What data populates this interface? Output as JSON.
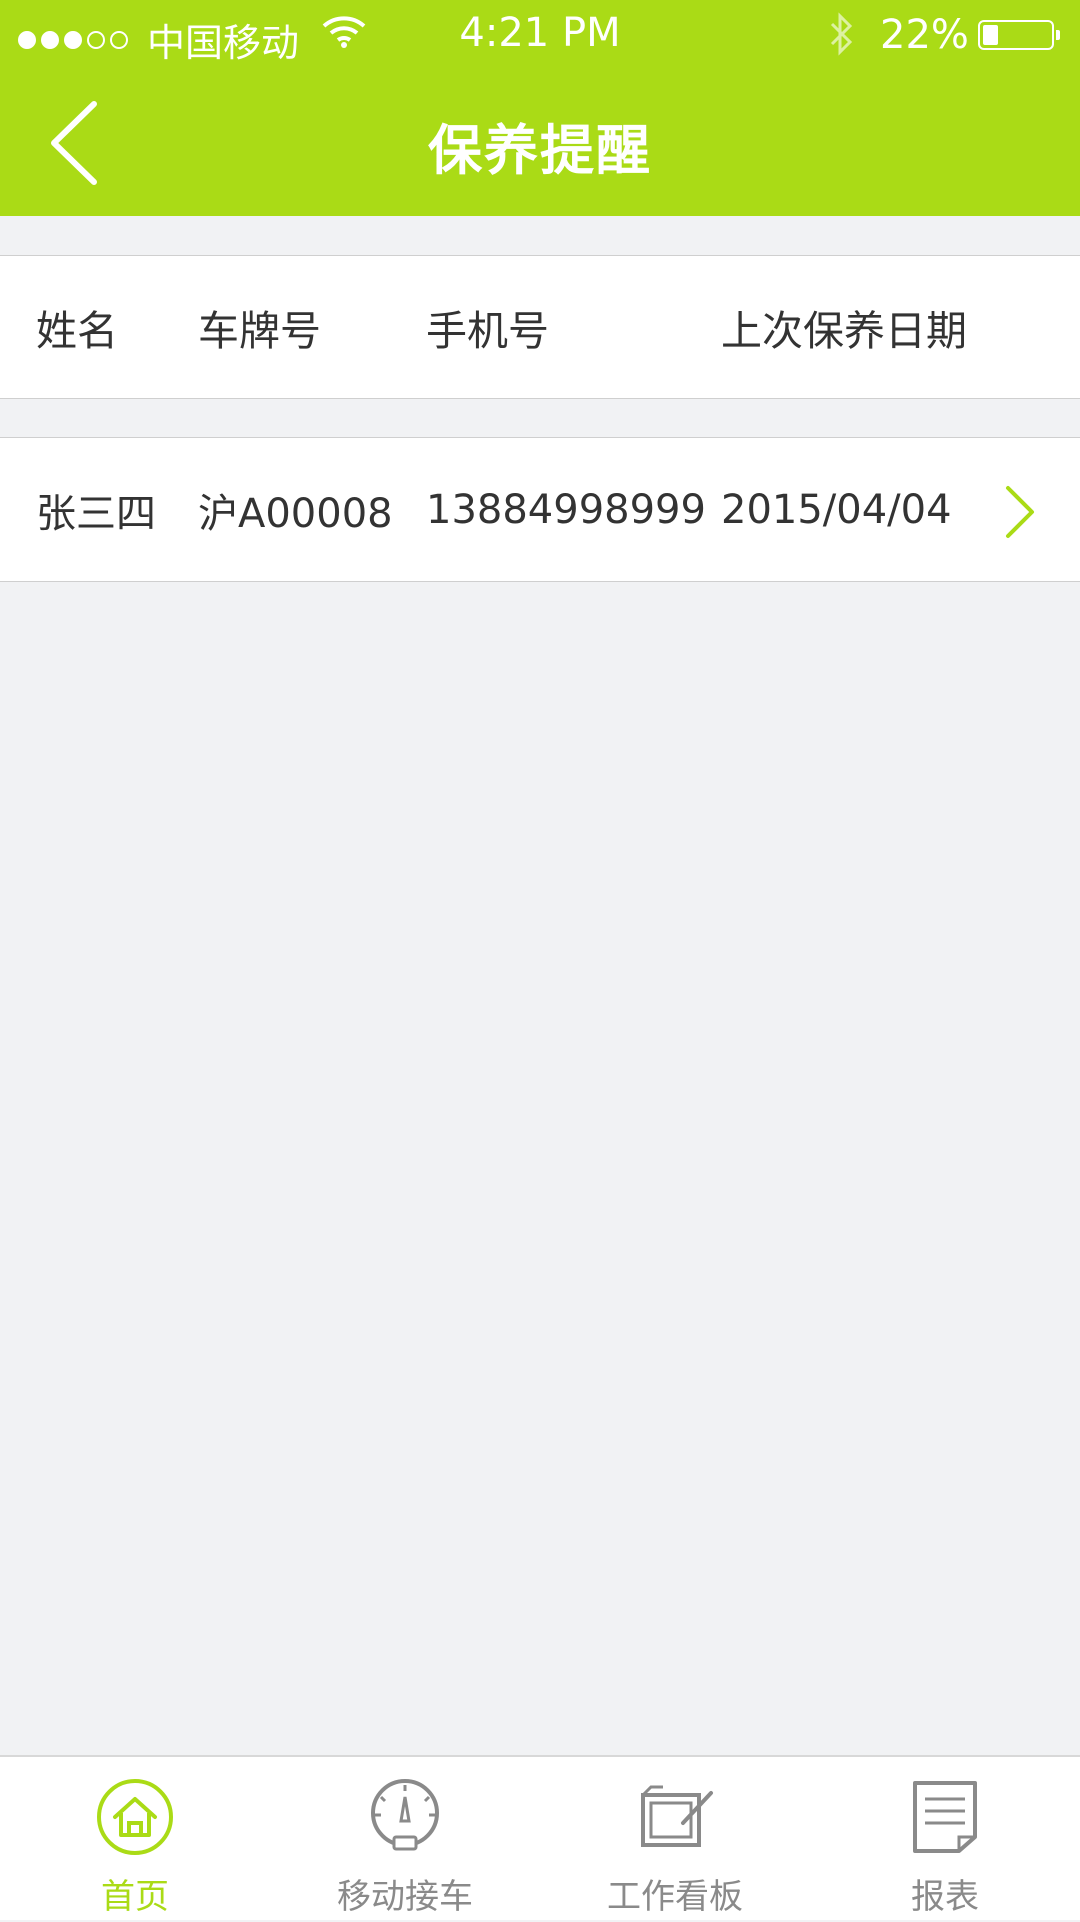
{
  "status_bar": {
    "signal_filled": 3,
    "signal_total": 5,
    "carrier": "中国移动",
    "time": "4:21 PM",
    "battery": "22%",
    "battery_level": 0.22
  },
  "nav": {
    "title": "保养提醒"
  },
  "table": {
    "headers": [
      "姓名",
      "车牌号",
      "手机号",
      "上次保养日期"
    ],
    "rows": [
      [
        "张三四",
        "沪A00008",
        "13884998999",
        "2015/04/04"
      ]
    ]
  },
  "tabs": [
    {
      "label": "首页",
      "icon": "home-icon",
      "active": true
    },
    {
      "label": "移动接车",
      "icon": "speedometer-icon",
      "active": false
    },
    {
      "label": "工作看板",
      "icon": "board-icon",
      "active": false
    },
    {
      "label": "报表",
      "icon": "report-icon",
      "active": false
    }
  ],
  "colors": {
    "accent": "#aadb16",
    "background": "#f1f2f4",
    "tab_inactive": "#8a8a8a"
  }
}
